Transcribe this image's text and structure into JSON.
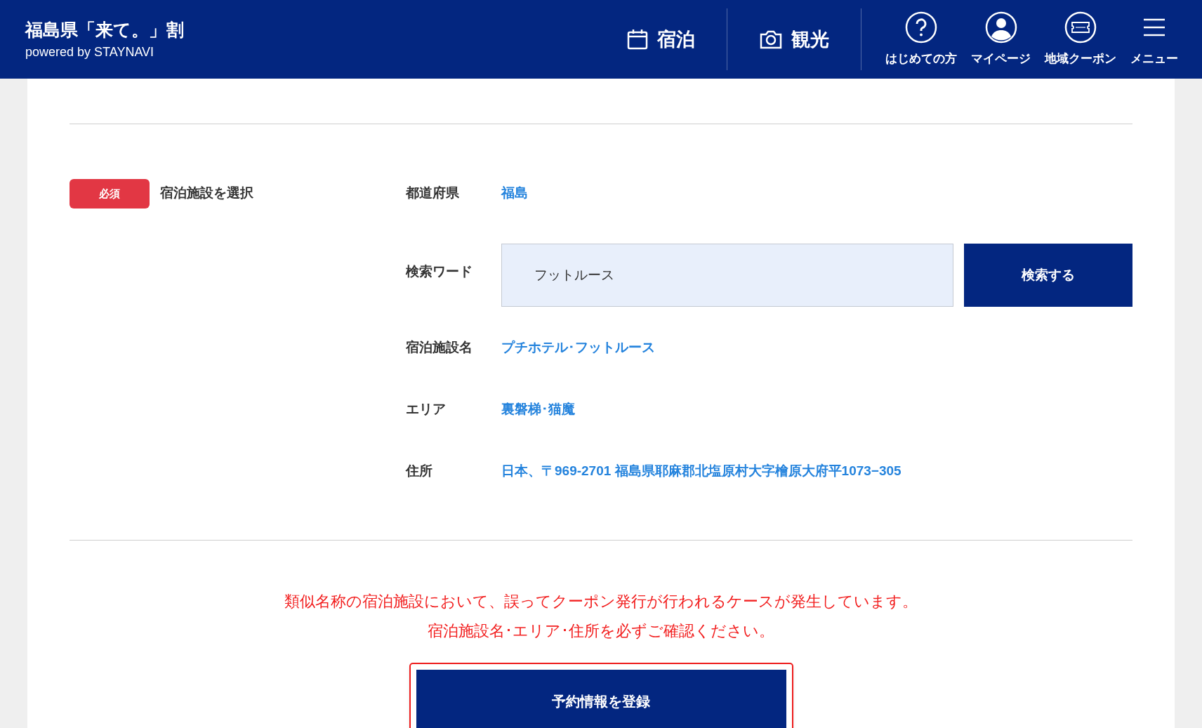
{
  "header": {
    "title": "福島県「来て。」割",
    "subtitle": "powered by STAYNAVI",
    "main_nav": [
      {
        "label": "宿泊",
        "kind": "calendar"
      },
      {
        "label": "観光",
        "kind": "camera"
      }
    ],
    "icon_nav": [
      {
        "label": "はじめての方",
        "kind": "help"
      },
      {
        "label": "マイページ",
        "kind": "user"
      },
      {
        "label": "地域クーポン",
        "kind": "coupon"
      },
      {
        "label": "メニュー",
        "kind": "menu"
      }
    ]
  },
  "form": {
    "required_badge": "必須",
    "section_label": "宿泊施設を選択",
    "rows": [
      {
        "kind": "text",
        "label": "都道府県",
        "value": "福島"
      },
      {
        "kind": "search",
        "label": "検索ワード",
        "value": "フットルース",
        "button": "検索する"
      },
      {
        "kind": "text",
        "label": "宿泊施設名",
        "value": "プチホテル･フットルース"
      },
      {
        "kind": "text",
        "label": "エリア",
        "value": "裏磐梯･猫魔"
      },
      {
        "kind": "text",
        "label": "住所",
        "value": "日本、〒969-2701 福島県耶麻郡北塩原村大字檜原大府平1073−305"
      }
    ]
  },
  "warning": [
    "類似名称の宿泊施設において、誤ってクーポン発行が行われるケースが発生しています。",
    "宿泊施設名･エリア･住所を必ずご確認ください。"
  ],
  "submit_button": "予約情報を登録"
}
